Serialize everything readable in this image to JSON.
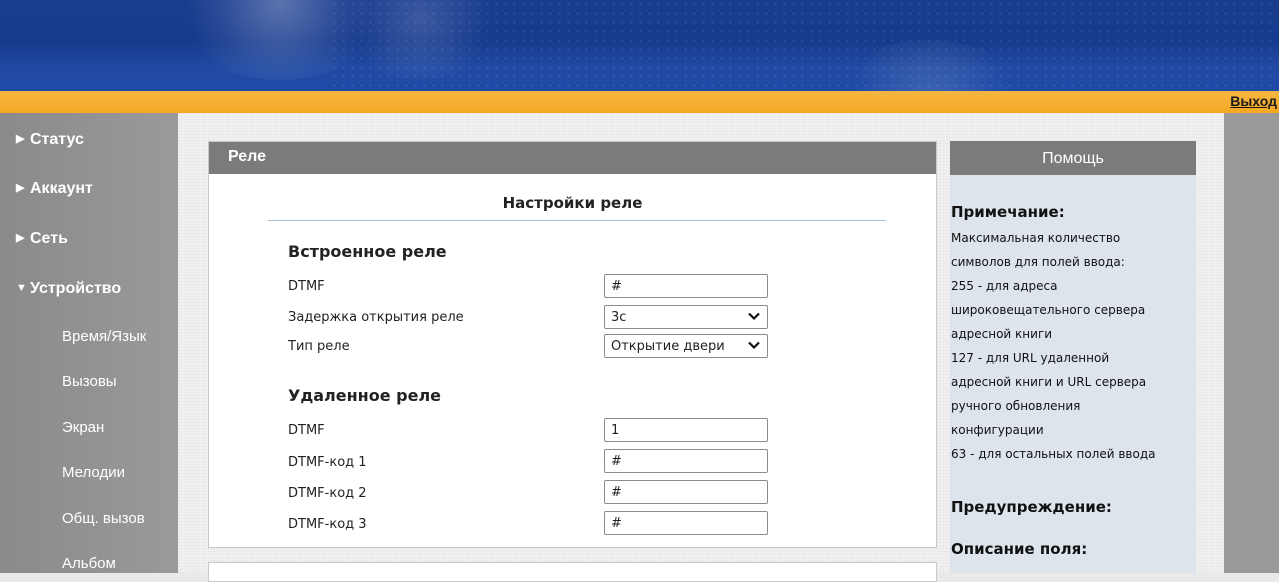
{
  "header": {
    "logout_label": "Выход"
  },
  "sidebar": {
    "items": [
      {
        "label": "Статус",
        "expanded": false
      },
      {
        "label": "Аккаунт",
        "expanded": false
      },
      {
        "label": "Сеть",
        "expanded": false
      },
      {
        "label": "Устройство",
        "expanded": true
      }
    ],
    "subitems": [
      "Время/Язык",
      "Вызовы",
      "Экран",
      "Мелодии",
      "Общ. вызов",
      "Альбом"
    ]
  },
  "panel": {
    "title": "Реле",
    "section_title": "Настройки реле",
    "builtin": {
      "title": "Встроенное реле",
      "dtmf_label": "DTMF",
      "dtmf_value": "#",
      "delay_label": "Задержка открытия реле",
      "delay_value": "3с",
      "type_label": "Тип реле",
      "type_value": "Открытие двери"
    },
    "remote": {
      "title": "Удаленное реле",
      "dtmf_label": "DTMF",
      "dtmf_value": "1",
      "code1_label": "DTMF-код 1",
      "code1_value": "#",
      "code2_label": "DTMF-код 2",
      "code2_value": "#",
      "code3_label": "DTMF-код 3",
      "code3_value": "#"
    }
  },
  "help": {
    "title": "Помощь",
    "note_heading": "Примечание:",
    "note_lines": [
      "Максимальная количество",
      "символов для полей ввода:",
      "255 - для адреса",
      "широковещательного сервера",
      "адресной книги",
      "127 - для URL удаленной",
      "адресной книги и URL сервера",
      "ручного обновления",
      "конфигурации",
      "63 - для остальных полей ввода"
    ],
    "warning_heading": "Предупреждение:",
    "field_desc_heading": "Описание поля:"
  }
}
